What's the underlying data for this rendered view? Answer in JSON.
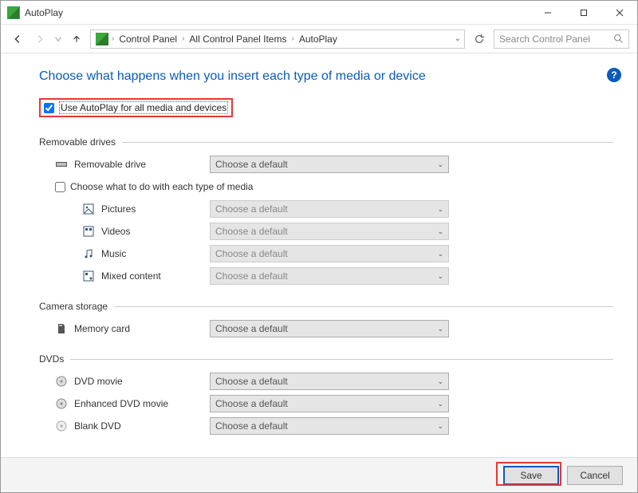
{
  "window": {
    "title": "AutoPlay"
  },
  "nav": {
    "breadcrumbs": [
      "Control Panel",
      "All Control Panel Items",
      "AutoPlay"
    ],
    "search_placeholder": "Search Control Panel"
  },
  "page": {
    "heading": "Choose what happens when you insert each type of media or device",
    "master_checkbox_label": "Use AutoPlay for all media and devices",
    "master_checkbox_checked": true,
    "sub_checkbox_label": "Choose what to do with each type of media",
    "sub_checkbox_checked": false,
    "default_choice": "Choose a default"
  },
  "sections": {
    "removable": {
      "title": "Removable drives",
      "item": {
        "label": "Removable drive"
      },
      "media": {
        "pictures": "Pictures",
        "videos": "Videos",
        "music": "Music",
        "mixed": "Mixed content"
      }
    },
    "camera": {
      "title": "Camera storage",
      "item": {
        "label": "Memory card"
      }
    },
    "dvd": {
      "title": "DVDs",
      "items": {
        "movie": "DVD movie",
        "enhanced": "Enhanced DVD movie",
        "blank": "Blank DVD"
      }
    }
  },
  "footer": {
    "save": "Save",
    "cancel": "Cancel"
  },
  "help": "?"
}
